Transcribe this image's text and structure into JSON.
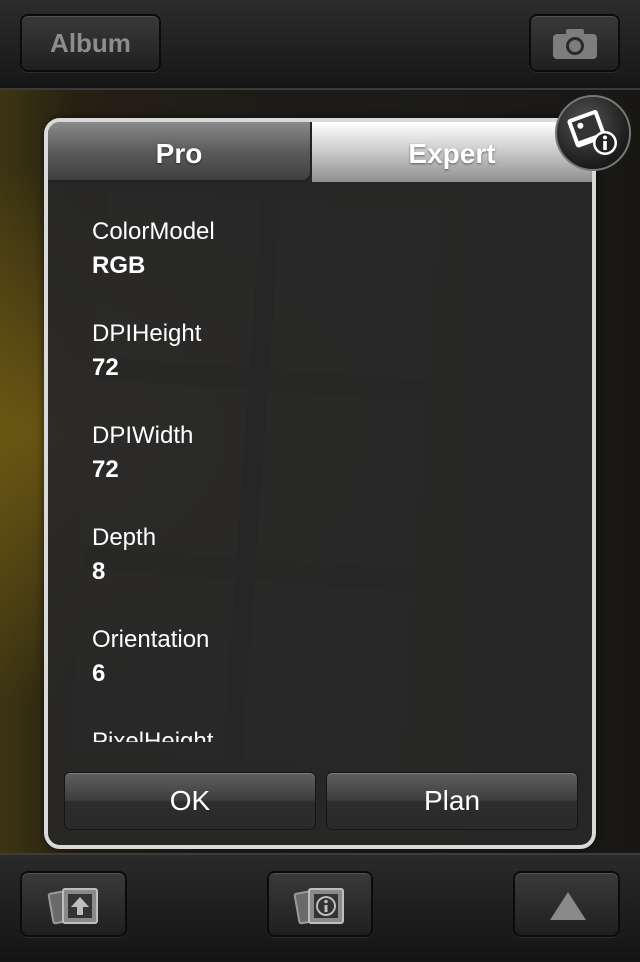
{
  "topbar": {
    "album_label": "Album",
    "camera_icon": "camera-icon"
  },
  "dialog": {
    "tabs": [
      {
        "label": "Pro",
        "selected": false
      },
      {
        "label": "Expert",
        "selected": true
      }
    ],
    "properties": [
      {
        "name": "ColorModel",
        "value": "RGB"
      },
      {
        "name": "DPIHeight",
        "value": "72"
      },
      {
        "name": "DPIWidth",
        "value": "72"
      },
      {
        "name": "Depth",
        "value": "8"
      },
      {
        "name": "Orientation",
        "value": "6"
      },
      {
        "name": "PixelHeight",
        "value": ""
      }
    ],
    "ok_label": "OK",
    "plan_label": "Plan"
  },
  "bottombar": {
    "icons": [
      "photo-upload-icon",
      "photo-info-icon",
      "triangle-up-icon"
    ]
  },
  "colors": {
    "accent": "#d9d9d9",
    "background": "#111111"
  }
}
